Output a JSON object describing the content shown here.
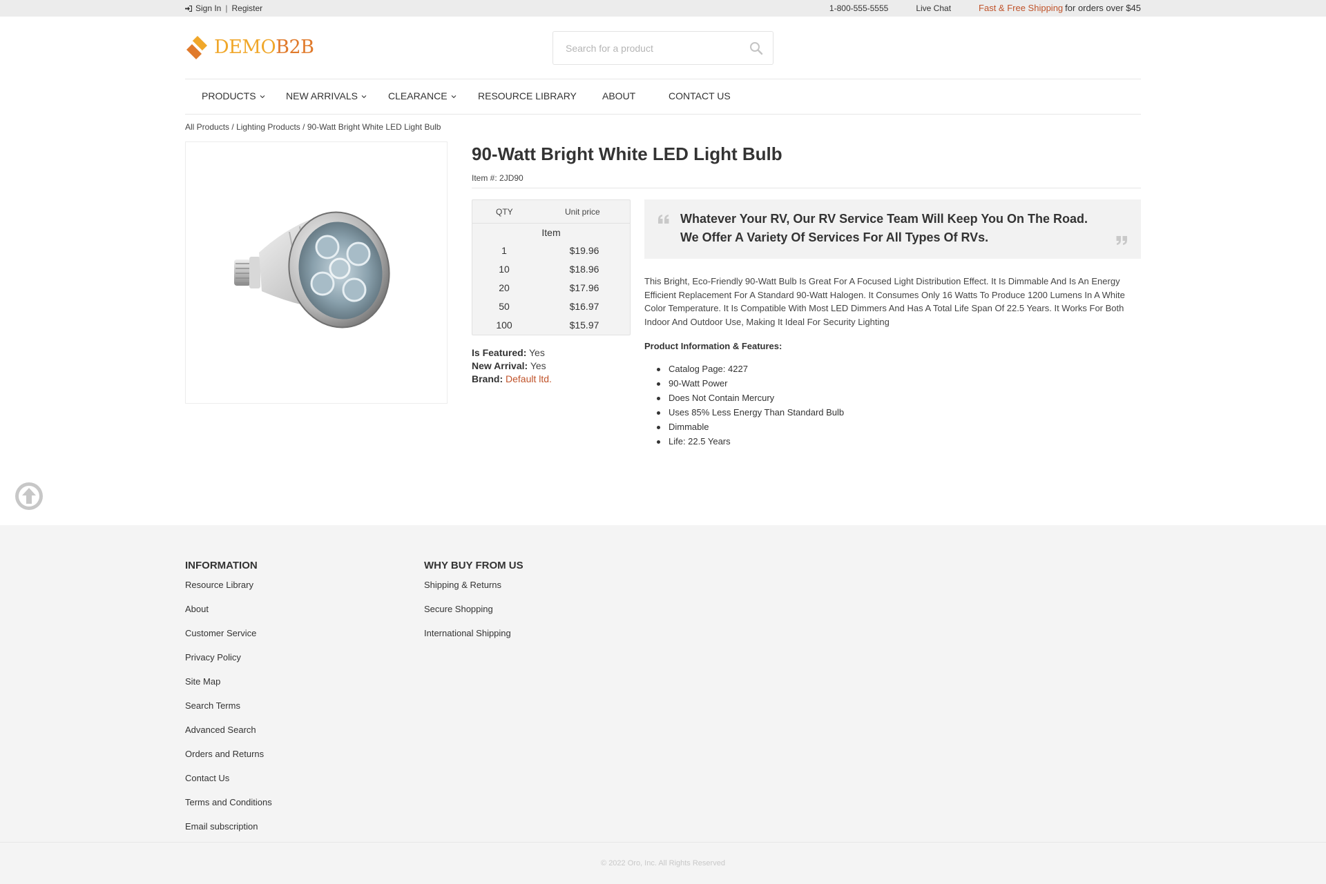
{
  "topbar": {
    "sign_in": "Sign In",
    "separator": "|",
    "register": "Register",
    "phone": "1-800-555-5555",
    "live_chat": "Live Chat",
    "shipping_highlight": "Fast & Free Shipping",
    "shipping_rest": "for orders over $45"
  },
  "logo": {
    "part1": "DEMO",
    "part2": "B2B"
  },
  "search": {
    "placeholder": "Search for a product"
  },
  "nav": {
    "items": [
      {
        "label": "PRODUCTS",
        "dropdown": true
      },
      {
        "label": "NEW ARRIVALS",
        "dropdown": true
      },
      {
        "label": "CLEARANCE",
        "dropdown": true
      },
      {
        "label": "RESOURCE LIBRARY",
        "dropdown": false
      },
      {
        "label": "ABOUT",
        "dropdown": false
      },
      {
        "label": "CONTACT US",
        "dropdown": false
      }
    ]
  },
  "breadcrumb": {
    "items": [
      "All Products",
      "Lighting Products",
      "90-Watt Bright White LED Light Bulb"
    ],
    "separator": "/"
  },
  "product": {
    "title": "90-Watt Bright White LED Light Bulb",
    "item_label": "Item #:",
    "item_number": "2JD90",
    "price_table": {
      "header_qty": "QTY",
      "header_price": "Unit price",
      "unit": "Item",
      "rows": [
        {
          "qty": "1",
          "price": "$19.96"
        },
        {
          "qty": "10",
          "price": "$18.96"
        },
        {
          "qty": "20",
          "price": "$17.96"
        },
        {
          "qty": "50",
          "price": "$16.97"
        },
        {
          "qty": "100",
          "price": "$15.97"
        }
      ]
    },
    "attributes": {
      "featured_label": "Is Featured:",
      "featured_value": "Yes",
      "new_arrival_label": "New Arrival:",
      "new_arrival_value": "Yes",
      "brand_label": "Brand:",
      "brand_value": "Default ltd."
    },
    "quote": "Whatever Your RV, Our RV Service Team Will Keep You On The Road. We Offer A Variety Of Services For All Types Of RVs.",
    "description": "This Bright, Eco-Friendly 90-Watt Bulb Is Great For A Focused Light Distribution Effect. It Is Dimmable And Is An Energy Efficient Replacement For A Standard 90-Watt Halogen. It Consumes Only 16 Watts To Produce 1200 Lumens In A White Color Temperature. It Is Compatible With Most LED Dimmers And Has A Total Life Span Of 22.5 Years. It Works For Both Indoor And Outdoor Use, Making It Ideal For Security Lighting",
    "features_title": "Product Information & Features:",
    "features": [
      "Catalog Page: 4227",
      "90-Watt Power",
      "Does Not Contain Mercury",
      "Uses 85% Less Energy Than Standard Bulb",
      "Dimmable",
      "Life: 22.5 Years"
    ]
  },
  "footer": {
    "col1": {
      "title": "INFORMATION",
      "links": [
        "Resource Library",
        "About",
        "Customer Service",
        "Privacy Policy",
        "Site Map",
        "Search Terms",
        "Advanced Search",
        "Orders and Returns",
        "Contact Us",
        "Terms and Conditions",
        "Email subscription"
      ]
    },
    "col2": {
      "title": "WHY BUY FROM US",
      "links": [
        "Shipping & Returns",
        "Secure Shopping",
        "International Shipping"
      ]
    },
    "copyright": "© 2022 Oro, Inc. All Rights Reserved"
  },
  "colors": {
    "accent": "#c0532a",
    "logo_yellow": "#f0a72a",
    "logo_orange": "#e07a2b",
    "footer_bg": "#f4f4f4",
    "topbar_bg": "#ececec"
  },
  "icons": {
    "sign_in": "sign-in-icon",
    "search": "search-icon",
    "dropdown": "chevron-down-icon",
    "quote_open": "quote-open-icon",
    "quote_close": "quote-close-icon",
    "back_to_top": "arrow-up-circle-icon"
  }
}
